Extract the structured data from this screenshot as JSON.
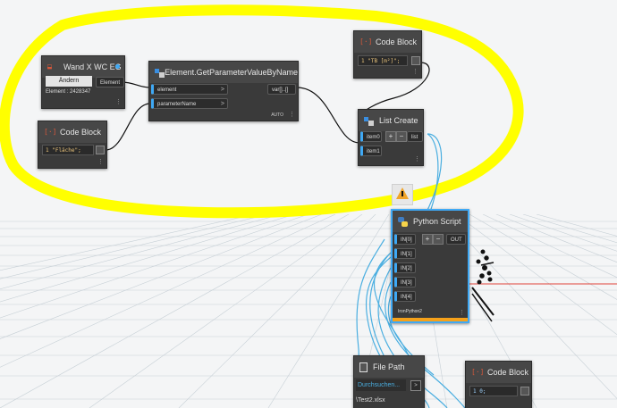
{
  "nodes": {
    "wand": {
      "title": "Wand X WC EG",
      "button_label": "Ändern",
      "element_caption": "Element : 2428347",
      "output_label": "Element"
    },
    "code_block_flaeche": {
      "title": "Code Block",
      "code": "1 \"Fläche\";"
    },
    "get_param": {
      "title": "Element.GetParameterValueByName",
      "input_1": "element",
      "input_2": "parameterName",
      "output": "var[]..[]",
      "lacing": "AUTO"
    },
    "code_block_tb": {
      "title": "Code Block",
      "code": "1 \"TB [m²]\";"
    },
    "list_create": {
      "title": "List Create",
      "input_1": "item0",
      "input_2": "item1",
      "output": "list",
      "add": "+",
      "remove": "−"
    },
    "python_script": {
      "title": "Python Script",
      "inputs": [
        "IN[0]",
        "IN[1]",
        "IN[2]",
        "IN[3]",
        "IN[4]"
      ],
      "output": "OUT",
      "engine": "IronPython2",
      "add": "+",
      "remove": "−"
    },
    "file_path": {
      "title": "File Path",
      "button_label": "Durchsuchen...",
      "value": "\\Test2.xlsx"
    },
    "code_block_zero": {
      "title": "Code Block",
      "code": "1 0;"
    }
  },
  "icons": {
    "code_block": "code-block-icon",
    "python": "python-icon",
    "function": "element-function-icon",
    "list": "list-create-icon",
    "file": "file-icon",
    "warning": "warning-icon"
  },
  "colors": {
    "highlight": "#ffff00",
    "wire": "#4aaee0",
    "selected": "#3fa9f5",
    "warning": "#f1a429",
    "preview_bar": "#f5a11a"
  }
}
